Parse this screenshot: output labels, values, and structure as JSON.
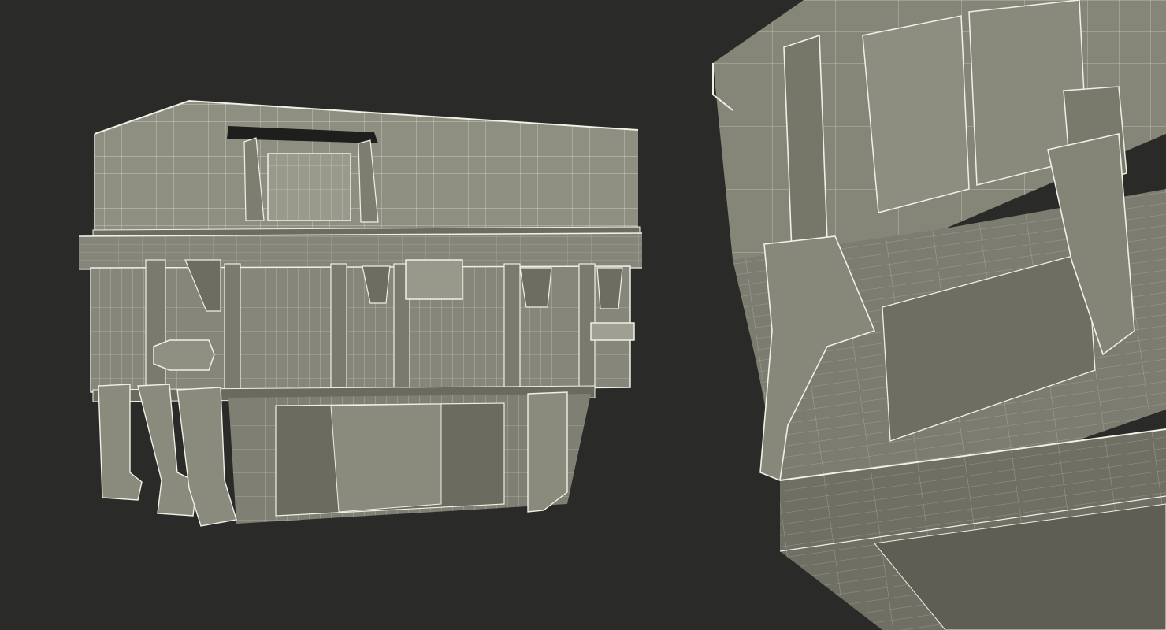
{
  "scene": {
    "type": "3d-wireframe-render",
    "views": [
      {
        "id": "overview",
        "subject": "box"
      },
      {
        "id": "closeup",
        "subject": "box-underside-detail"
      }
    ],
    "colors": {
      "background": "#2a2a29",
      "surface": "#8c8c7e",
      "surface_light": "#a3a395",
      "surface_dark": "#5f5f55",
      "shadow": "#3a3a35",
      "wire": "#e8e8dc"
    }
  }
}
